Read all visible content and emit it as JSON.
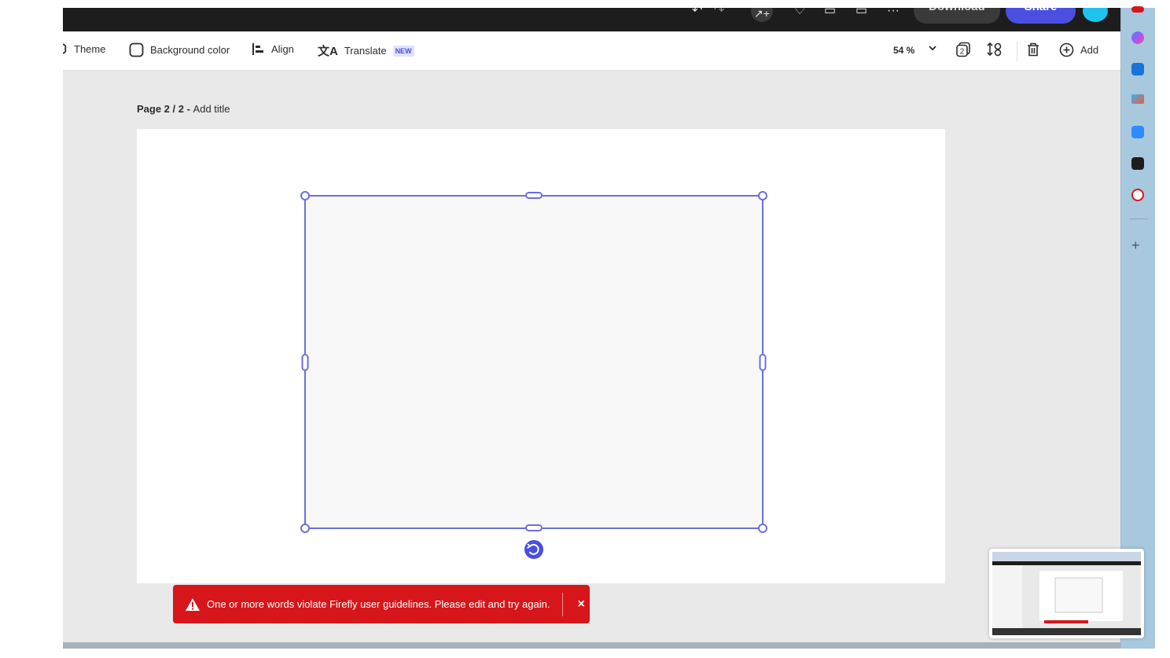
{
  "topbar": {
    "download_label": "Download",
    "share_label": "Share",
    "icons": [
      "undo-icon",
      "redo-icon",
      "invite-icon",
      "lightbulb-icon",
      "comment-icon",
      "chat-icon",
      "more-icon"
    ]
  },
  "toolbar": {
    "theme_label": "Theme",
    "background_color_label": "Background color",
    "align_label": "Align",
    "translate_label": "Translate",
    "translate_badge": "NEW",
    "zoom_value": "54 %",
    "add_label": "Add"
  },
  "canvas": {
    "page_label_prefix": "Page 2 / 2",
    "page_label_sep": " - ",
    "page_title_placeholder": "Add title"
  },
  "toast": {
    "message": "One or more words violate Firefly user guidelines. Please edit and try again.",
    "close_label": "×",
    "color": "#d7161b"
  },
  "colors": {
    "accent": "#4b4fe0",
    "selection": "#6b6fdb"
  },
  "rightrail": {
    "icons": [
      "copilot-icon",
      "outlook-icon",
      "app-icon",
      "zoom-meeting-icon",
      "chatgpt-icon",
      "news-icon"
    ]
  }
}
